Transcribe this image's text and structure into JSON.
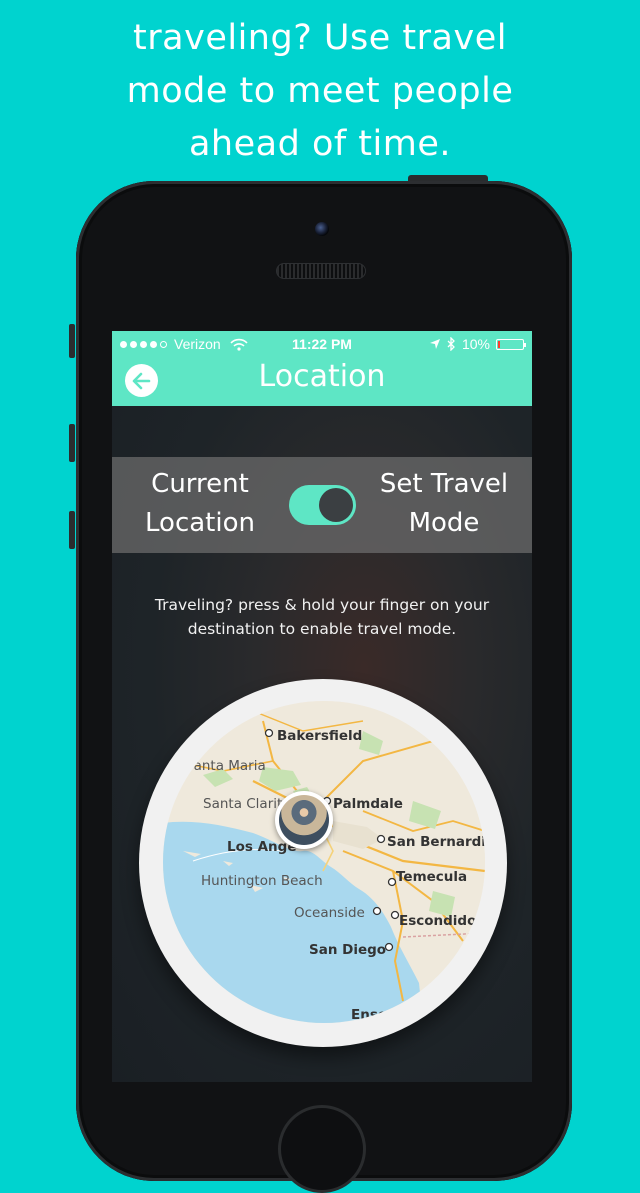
{
  "headline": {
    "line1": "traveling? Use travel",
    "line2": "mode to meet people",
    "line3": "ahead of time."
  },
  "status_bar": {
    "carrier": "Verizon",
    "time": "11:22 PM",
    "battery": "10%",
    "battery_level": 0.1,
    "signal_bars_filled": 4,
    "signal_bars_total": 5
  },
  "nav": {
    "title": "Location",
    "back_icon": "back-arrow-icon"
  },
  "toggle": {
    "left_line1": "Current",
    "left_line2": "Location",
    "right_line1": "Set Travel",
    "right_line2": "Mode",
    "state": "on"
  },
  "hint": {
    "line1": "Traveling? press & hold your finger on your",
    "line2": "destination to enable travel mode."
  },
  "map": {
    "cities": {
      "bakersfield": "Bakersfield",
      "santa_maria": "Santa Maria",
      "santa_clarita": "Santa Clarita",
      "palmdale": "Palmdale",
      "los_angeles": "Los Ange",
      "san_bernardino": "San Bernardin",
      "huntington_beach": "Huntington Beach",
      "temecula": "Temecula",
      "oceanside": "Oceanside",
      "escondido": "Escondido",
      "san_diego": "San Diego",
      "ensenada": "Ensena"
    }
  },
  "colors": {
    "background": "#00d3cf",
    "accent": "#5ee6c5",
    "battery_low": "#ff3b30",
    "water": "#a9d8ee"
  }
}
